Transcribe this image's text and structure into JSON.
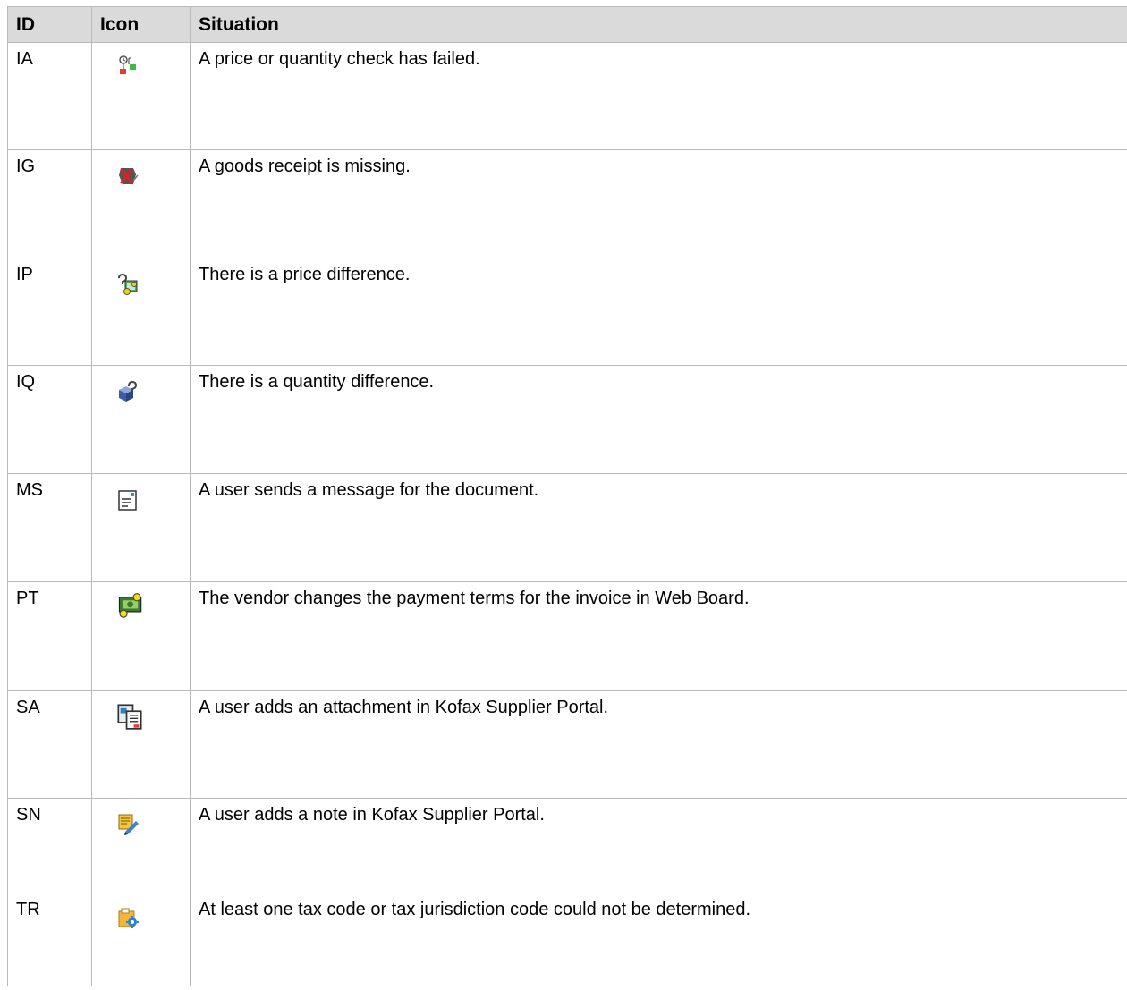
{
  "table": {
    "headers": {
      "id": "ID",
      "icon": "Icon",
      "situation": "Situation"
    },
    "rows": [
      {
        "id": "IA",
        "icon": "price-quantity-check-failed-icon",
        "situation": "A price or quantity check has failed."
      },
      {
        "id": "IG",
        "icon": "goods-receipt-missing-icon",
        "situation": "A goods receipt is missing."
      },
      {
        "id": "IP",
        "icon": "price-difference-icon",
        "situation": "There is a price difference."
      },
      {
        "id": "IQ",
        "icon": "quantity-difference-icon",
        "situation": "There is a quantity difference."
      },
      {
        "id": "MS",
        "icon": "message-icon",
        "situation": "A user sends a message for the document."
      },
      {
        "id": "PT",
        "icon": "payment-terms-icon",
        "situation": "The vendor changes the payment terms for the invoice in Web Board."
      },
      {
        "id": "SA",
        "icon": "attachment-icon",
        "situation": "A user adds an attachment in Kofax Supplier Portal."
      },
      {
        "id": "SN",
        "icon": "note-icon",
        "situation": "A user adds a note in Kofax Supplier Portal."
      },
      {
        "id": "TR",
        "icon": "tax-code-icon",
        "situation": "At least one tax code or tax jurisdiction code could not be determined."
      }
    ]
  }
}
